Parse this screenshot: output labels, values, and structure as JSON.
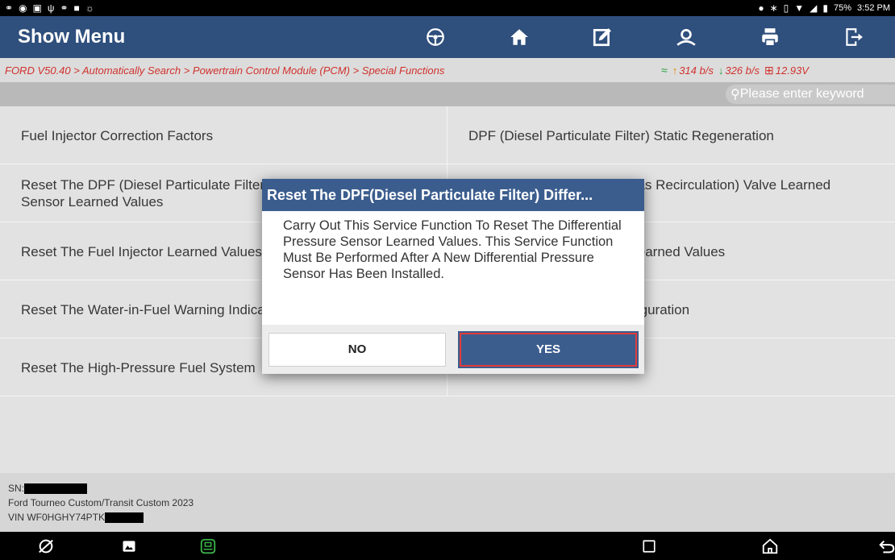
{
  "status_bar": {
    "battery": "75%",
    "time": "3:52 PM"
  },
  "header": {
    "title": "Show Menu",
    "buttons": [
      "steering-wheel-icon",
      "home-icon",
      "edit-report-icon",
      "user-icon",
      "print-icon",
      "exit-icon"
    ]
  },
  "breadcrumb": {
    "path": "FORD V50.40 > Automatically Search > Powertrain Control Module (PCM) > Special Functions",
    "upload": "314 b/s",
    "download": "326 b/s",
    "voltage": "12.93V"
  },
  "search": {
    "placeholder": "Please enter keyword"
  },
  "functions": [
    [
      "Fuel Injector Correction Factors",
      "DPF (Diesel Particulate Filter) Static Regeneration"
    ],
    [
      "Reset The DPF (Diesel Particulate Filter) Differential Pressure Sensor Learned Values",
      "Reset The EGR (Exhaust Gas Recirculation) Valve Learned Values"
    ],
    [
      "Reset The Fuel Injector Learned Values",
      "Reset The Cut-off Throttle Learned Values"
    ],
    [
      "Reset The Water-in-Fuel Warning Indicator",
      "Vehicle Speed Control Configuration"
    ],
    [
      "Reset The High-Pressure Fuel System",
      ""
    ]
  ],
  "dialog": {
    "title": "Reset The DPF(Diesel Particulate Filter) Differ...",
    "message": "Carry Out This Service Function To Reset The Differential Pressure Sensor Learned Values. This Service Function Must Be Performed After A New Differential Pressure Sensor Has Been Installed.",
    "no_label": "NO",
    "yes_label": "YES"
  },
  "vehicle": {
    "sn_label": "SN:",
    "model": "Ford Tourneo Custom/Transit Custom 2023",
    "vin": "VIN WF0HGHY74PTK"
  },
  "colors": {
    "header": "#2f4f7d",
    "dialog_title": "#3b5d8e",
    "breadcrumb_text": "#d0312d",
    "yes_border": "#e23b3b"
  }
}
